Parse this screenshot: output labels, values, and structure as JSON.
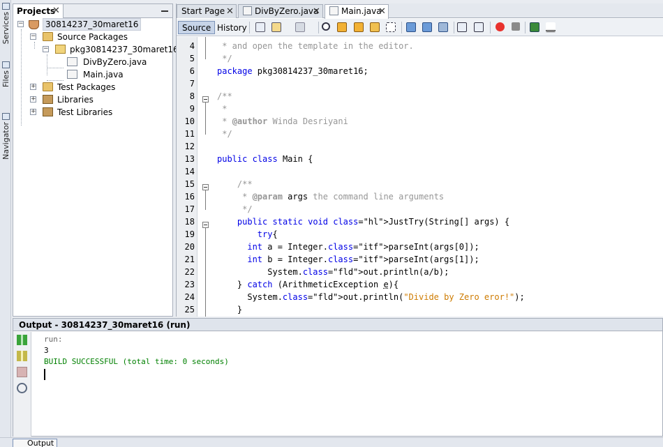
{
  "sidebar_tabs": [
    "Services",
    "Files",
    "Navigator"
  ],
  "projects": {
    "tab_label": "Projects",
    "tree": [
      {
        "label": "30814237_30maret16",
        "icon": "project-cup-icon"
      },
      {
        "label": "Source Packages",
        "icon": "folder-icon"
      },
      {
        "label": "pkg30814237_30maret16",
        "icon": "package-icon"
      },
      {
        "label": "DivByZero.java",
        "icon": "java-file-icon"
      },
      {
        "label": "Main.java",
        "icon": "java-file-icon"
      },
      {
        "label": "Test Packages",
        "icon": "folder-icon"
      },
      {
        "label": "Libraries",
        "icon": "library-icon"
      },
      {
        "label": "Test Libraries",
        "icon": "library-icon"
      }
    ]
  },
  "editor": {
    "tabs": [
      "Start Page",
      "DivByZero.java",
      "Main.java"
    ],
    "active_tab": "Main.java",
    "view_buttons": [
      "Source",
      "History"
    ],
    "lines": [
      {
        "n": "4",
        "code": " * and open the template in the editor."
      },
      {
        "n": "5",
        "code": " */"
      },
      {
        "n": "6",
        "code": "package pkg30814237_30maret16;"
      },
      {
        "n": "7",
        "code": ""
      },
      {
        "n": "8",
        "code": "/**"
      },
      {
        "n": "9",
        "code": " *"
      },
      {
        "n": "10",
        "code": " * @author Winda Desriyani"
      },
      {
        "n": "11",
        "code": " */"
      },
      {
        "n": "12",
        "code": ""
      },
      {
        "n": "13",
        "code": "public class Main {"
      },
      {
        "n": "14",
        "code": ""
      },
      {
        "n": "15",
        "code": "    /**"
      },
      {
        "n": "16",
        "code": "     * @param args the command line arguments"
      },
      {
        "n": "17",
        "code": "     */"
      },
      {
        "n": "18",
        "code": "    public static void JustTry(String[] args) {"
      },
      {
        "n": "19",
        "code": "        try{"
      },
      {
        "n": "20",
        "code": "      int a = Integer.parseInt(args[0]);"
      },
      {
        "n": "21",
        "code": "      int b = Integer.parseInt(args[1]);"
      },
      {
        "n": "22",
        "code": "          System.out.println(a/b);"
      },
      {
        "n": "23",
        "code": "    } catch (ArithmeticException e){"
      },
      {
        "n": "24",
        "code": "      System.out.println(\"Divide by Zero eror!\");"
      },
      {
        "n": "25",
        "code": "    }"
      }
    ]
  },
  "output": {
    "title": "Output - 30814237_30maret16 (run)",
    "lines": [
      "run:",
      "3",
      "BUILD SUCCESSFUL (total time: 0 seconds)"
    ],
    "colors": {
      "run": "#666666",
      "value": "#000000",
      "success": "#008000"
    }
  },
  "bottom_tab": "Output",
  "colors": {
    "keyword": "#0000e6",
    "comment": "#969696",
    "string": "#ce7b00",
    "highlight": "#f1ed9b"
  }
}
